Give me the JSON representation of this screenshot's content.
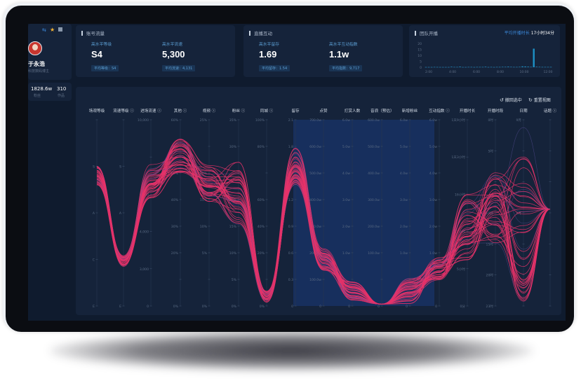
{
  "user": {
    "name": "于永浩",
    "subtitle": "科技数码博主",
    "stat1_value": "1828.6w",
    "stat1_label": "粉丝",
    "stat2_value": "310",
    "stat2_label": "作品"
  },
  "account": {
    "title": "账号流量",
    "metrics": [
      {
        "label": "高水平等级",
        "value": "S4",
        "pill": "平均等级：S4"
      },
      {
        "label": "高水平流速",
        "value": "5,300",
        "pill": "平均流速：4,131"
      }
    ]
  },
  "live": {
    "title": "直播互动",
    "metrics": [
      {
        "label": "高水平留存",
        "value": "1.69",
        "pill": "平均留存：1.54"
      },
      {
        "label": "高水平互动指数",
        "value": "1.1w",
        "pill": "平均指数：9,717"
      }
    ]
  },
  "team": {
    "title": "团队开播",
    "avg_label": "平均开播时长",
    "avg_value": "17小时34分",
    "y_ticks": [
      "20",
      "15",
      "10",
      "5",
      "0"
    ],
    "x_ticks": [
      "2:00",
      "4:00",
      "6:00",
      "8:00",
      "10:00",
      "12:00"
    ],
    "bars": [
      0.2,
      0.2,
      0.2,
      0.3,
      0.25,
      0.2,
      0.2,
      0.2,
      0.2,
      0.5,
      0.3,
      0.3,
      0.6,
      0.2,
      0.2,
      0.3,
      0.3,
      0.2,
      0.3,
      0.3,
      0.3,
      0.5,
      0.2,
      0.3,
      0.2,
      0.3,
      0.3,
      0.4,
      0.4,
      0.6,
      0.4,
      0.3,
      0.3,
      0.4,
      0.9,
      0.8,
      0.6,
      0.4,
      19.5,
      0.5,
      0.4,
      0.3,
      0.3,
      0.3,
      0.3
    ]
  },
  "parallel": {
    "buttons": {
      "undo": "撤回选中",
      "reset": "重置视图"
    },
    "axes": [
      {
        "name": "场观等级",
        "ticks": [
          "",
          "S",
          "A",
          "C",
          "E"
        ],
        "help": false
      },
      {
        "name": "流速等级",
        "ticks": [
          "",
          "S",
          "A",
          "C",
          "E"
        ],
        "help": true
      },
      {
        "name": "进场流速",
        "ticks": [
          "10,000",
          "",
          "6,000",
          "4,000",
          "3,000",
          "0"
        ],
        "help": true
      },
      {
        "name": "其他",
        "ticks": [
          "60%",
          "",
          "50%",
          "40%",
          "30%",
          "20%",
          "",
          "0%"
        ],
        "help": true
      },
      {
        "name": "视频",
        "ticks": [
          "25%",
          "",
          "20%",
          "15%",
          "10%",
          "5%",
          "",
          "0%"
        ],
        "help": true
      },
      {
        "name": "粉丝",
        "ticks": [
          "35%",
          "30%",
          "",
          "20%",
          "15%",
          "10%",
          "5%",
          "0%"
        ],
        "help": true
      },
      {
        "name": "同城",
        "ticks": [
          "100%",
          "80%",
          "",
          "60%",
          "40%",
          "20%",
          "",
          "0%"
        ],
        "help": true
      },
      {
        "name": "留存",
        "ticks": [
          "2.1",
          "1.8",
          "1.5",
          "1.2",
          "0.9",
          "0.6",
          "0.3",
          "0"
        ],
        "help": false
      },
      {
        "name": "点赞",
        "ticks": [
          "700.0w",
          "600.0w",
          "500.0w",
          "400.0w",
          "300.0w",
          "200.0w",
          "100.0w",
          "0"
        ],
        "help": false
      },
      {
        "name": "打赏人数",
        "ticks": [
          "6.0w",
          "5.0w",
          "4.0w",
          "3.0w",
          "2.0w",
          "1.0w",
          "",
          "0"
        ],
        "help": false
      },
      {
        "name": "音浪（预估）",
        "ticks": [
          "600.0w",
          "500.0w",
          "400.0w",
          "300.0w",
          "200.0w",
          "100.0w",
          "",
          "0"
        ],
        "help": false
      },
      {
        "name": "新增粉丝",
        "ticks": [
          "6.0w",
          "5.0w",
          "4.0w",
          "3.0w",
          "2.0w",
          "1.0w",
          "",
          "0"
        ],
        "help": false
      },
      {
        "name": "互动指数",
        "ticks": [
          "6.0w",
          "5.0w",
          "4.0w",
          "3.0w",
          "2.0w",
          "1.0w",
          "",
          "0"
        ],
        "help": true
      },
      {
        "name": "开播时长",
        "ticks": [
          "1天9小时",
          "1天3小时",
          "16小时",
          "11小时",
          "5小时",
          "0分"
        ],
        "help": false
      },
      {
        "name": "开播时段",
        "ticks": [
          "0时",
          "5时",
          "",
          "10时",
          "15时",
          "20时",
          "23时"
        ],
        "help": false
      },
      {
        "name": "日期",
        "ticks": [
          "9月",
          "",
          "",
          "9月",
          "",
          "",
          ""
        ],
        "help": false
      },
      {
        "name": "话题",
        "ticks": [
          "",
          "",
          "",
          "",
          "",
          "",
          ""
        ],
        "help": true
      }
    ],
    "colors": {
      "line": "#e8326a",
      "brush": "#1a3a7a"
    }
  }
}
